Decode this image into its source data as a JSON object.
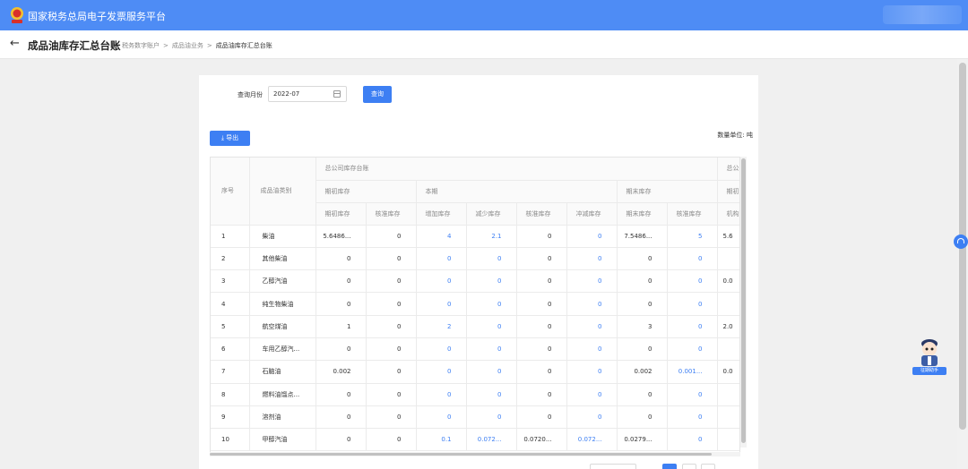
{
  "app": {
    "title": "国家税务总局电子发票服务平台"
  },
  "nav": {
    "back_icon": "←",
    "page_title": "成品油库存汇总台账",
    "breadcrumb": [
      "税务数字账户",
      "成品油业务",
      "成品油库存汇总台账"
    ],
    "breadcrumb_sep": ">"
  },
  "query": {
    "month_label": "查询月份",
    "month_value": "2022-07",
    "query_button": "查询"
  },
  "toolbar": {
    "export_label": "导出",
    "export_icon": "download-icon",
    "unit_text": "数量单位: 吨"
  },
  "table": {
    "group_header": "总公司库存台账",
    "group_header_right": "总公",
    "seq_header": "序号",
    "type_header": "成品油类别",
    "sub_opening": "期初库存",
    "sub_current": "本期",
    "sub_closing": "期末库存",
    "sub_right": "期初",
    "columns": [
      "期初库存",
      "核准库存",
      "增加库存",
      "减少库存",
      "核准库存",
      "冲减库存",
      "期末库存",
      "核准库存",
      "机构"
    ],
    "rows": [
      {
        "seq": "1",
        "name": "柴油",
        "c": [
          "5.6486...",
          "0",
          "4",
          "2.1",
          "0",
          "0",
          "7.5486...",
          "5",
          "5.6"
        ]
      },
      {
        "seq": "2",
        "name": "其他柴油",
        "c": [
          "0",
          "0",
          "0",
          "0",
          "0",
          "0",
          "0",
          "0",
          ""
        ]
      },
      {
        "seq": "3",
        "name": "乙醇汽油",
        "c": [
          "0",
          "0",
          "0",
          "0",
          "0",
          "0",
          "0",
          "0",
          "0.0"
        ]
      },
      {
        "seq": "4",
        "name": "纯生物柴油",
        "c": [
          "0",
          "0",
          "0",
          "0",
          "0",
          "0",
          "0",
          "0",
          ""
        ]
      },
      {
        "seq": "5",
        "name": "航空煤油",
        "c": [
          "1",
          "0",
          "2",
          "0",
          "0",
          "0",
          "3",
          "0",
          "2.0"
        ]
      },
      {
        "seq": "6",
        "name": "车用乙醇汽...",
        "c": [
          "0",
          "0",
          "0",
          "0",
          "0",
          "0",
          "0",
          "0",
          ""
        ]
      },
      {
        "seq": "7",
        "name": "石脑油",
        "c": [
          "0.002",
          "0",
          "0",
          "0",
          "0",
          "0",
          "0.002",
          "0.001...",
          "0.0"
        ]
      },
      {
        "seq": "8",
        "name": "燃料油馏点...",
        "c": [
          "0",
          "0",
          "0",
          "0",
          "0",
          "0",
          "0",
          "0",
          ""
        ]
      },
      {
        "seq": "9",
        "name": "溶剂油",
        "c": [
          "0",
          "0",
          "0",
          "0",
          "0",
          "0",
          "0",
          "0",
          ""
        ]
      },
      {
        "seq": "10",
        "name": "甲醇汽油",
        "c": [
          "0",
          "0",
          "0.1",
          "0.072...",
          "0.0720...",
          "0.072...",
          "0.0279...",
          "0",
          ""
        ]
      }
    ],
    "blue_cols": [
      2,
      3,
      5,
      7
    ]
  },
  "assistant": {
    "label": "征期助手"
  },
  "colors": {
    "brand_blue": "#4e8cf5",
    "link_blue": "#3d7ff3"
  }
}
